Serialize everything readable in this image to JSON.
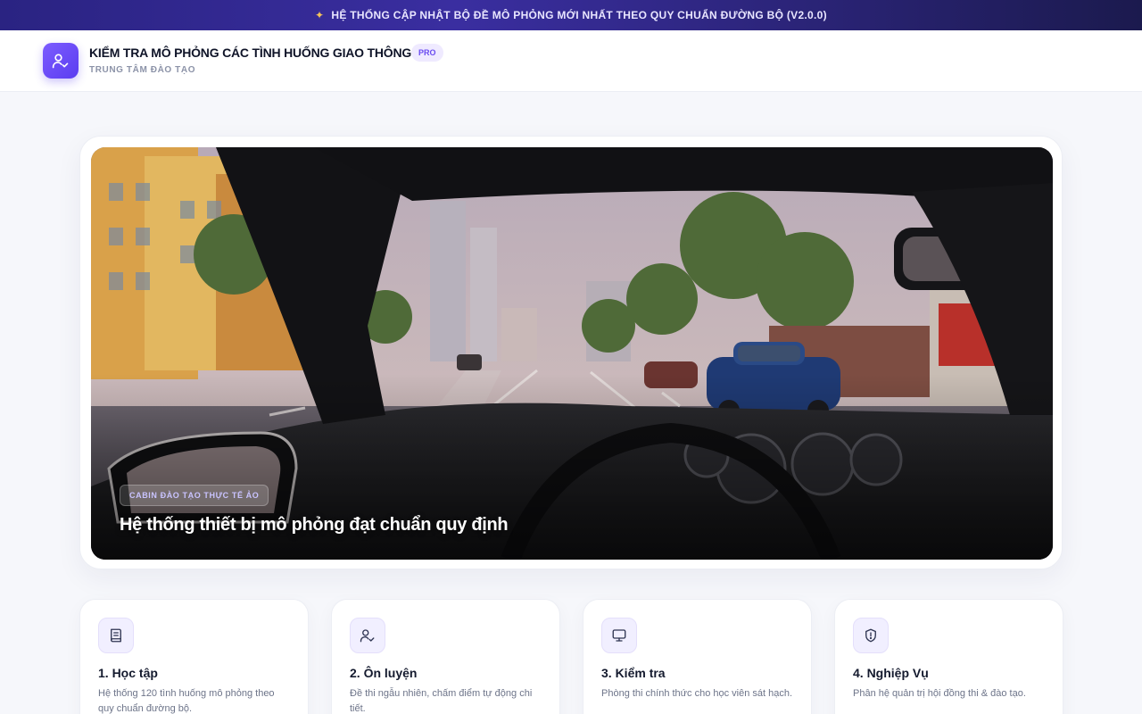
{
  "announcement": {
    "icon": "sparkle-icon",
    "text": "HỆ THỐNG CẬP NHẬT BỘ ĐỀ MÔ PHỎNG MỚI NHẤT THEO QUY CHUẨN ĐƯỜNG BỘ (V2.0.0)"
  },
  "header": {
    "logo_icon": "user-check-icon",
    "title": "KIỂM TRA MÔ PHỎNG CÁC TÌNH HUỐNG GIAO THÔNG",
    "badge": "PRO",
    "subtitle": "TRUNG TÂM ĐÀO TẠO"
  },
  "hero": {
    "tag": "CABIN ĐÀO TẠO THỰC TẾ ẢO",
    "caption": "Hệ thống thiết bị mô phỏng đạt chuẩn quy định"
  },
  "features": [
    {
      "icon": "book-icon",
      "title": "1. Học tập",
      "desc": "Hệ thống 120 tình huống mô phỏng theo quy chuẩn đường bộ."
    },
    {
      "icon": "user-check-icon",
      "title": "2. Ôn luyện",
      "desc": "Đề thi ngẫu nhiên, chấm điểm tự động chi tiết."
    },
    {
      "icon": "monitor-icon",
      "title": "3. Kiểm tra",
      "desc": "Phòng thi chính thức cho học viên sát hạch."
    },
    {
      "icon": "shield-alert-icon",
      "title": "4. Nghiệp Vụ",
      "desc": "Phân hệ quản trị hội đồng thi & đào tạo."
    }
  ],
  "colors": {
    "accent": "#6a4cf0",
    "banner": "#2a2382"
  }
}
